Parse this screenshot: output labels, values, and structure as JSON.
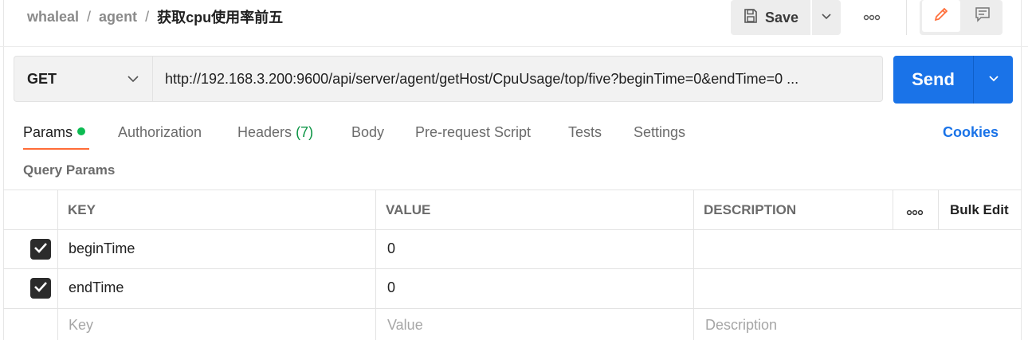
{
  "breadcrumb": {
    "workspace": "whaleal",
    "collection": "agent",
    "request": "获取cpu使用率前五"
  },
  "toolbar": {
    "save_label": "Save"
  },
  "request": {
    "method": "GET",
    "url": "http://192.168.3.200:9600/api/server/agent/getHost/CpuUsage/top/five?beginTime=0&endTime=0 ...",
    "send_label": "Send"
  },
  "tabs": {
    "params": "Params",
    "authorization": "Authorization",
    "headers": "Headers",
    "headers_count": "(7)",
    "body": "Body",
    "pre_request": "Pre-request Script",
    "tests": "Tests",
    "settings": "Settings",
    "cookies": "Cookies"
  },
  "params": {
    "section_title": "Query Params",
    "columns": {
      "key": "KEY",
      "value": "VALUE",
      "description": "DESCRIPTION",
      "bulk_edit": "Bulk Edit"
    },
    "rows": [
      {
        "checked": true,
        "key": "beginTime",
        "value": "0",
        "description": ""
      },
      {
        "checked": true,
        "key": "endTime",
        "value": "0",
        "description": ""
      }
    ],
    "placeholder": {
      "key": "Key",
      "value": "Value",
      "description": "Description"
    }
  },
  "colors": {
    "accent": "#1a73e8",
    "active_tab": "#ff6c37",
    "params_dot": "#0cbb52"
  },
  "icons": [
    "save-icon",
    "chevron-down-icon",
    "more-horizontal-icon",
    "pencil-icon",
    "comment-icon",
    "checkbox-checked-icon"
  ]
}
